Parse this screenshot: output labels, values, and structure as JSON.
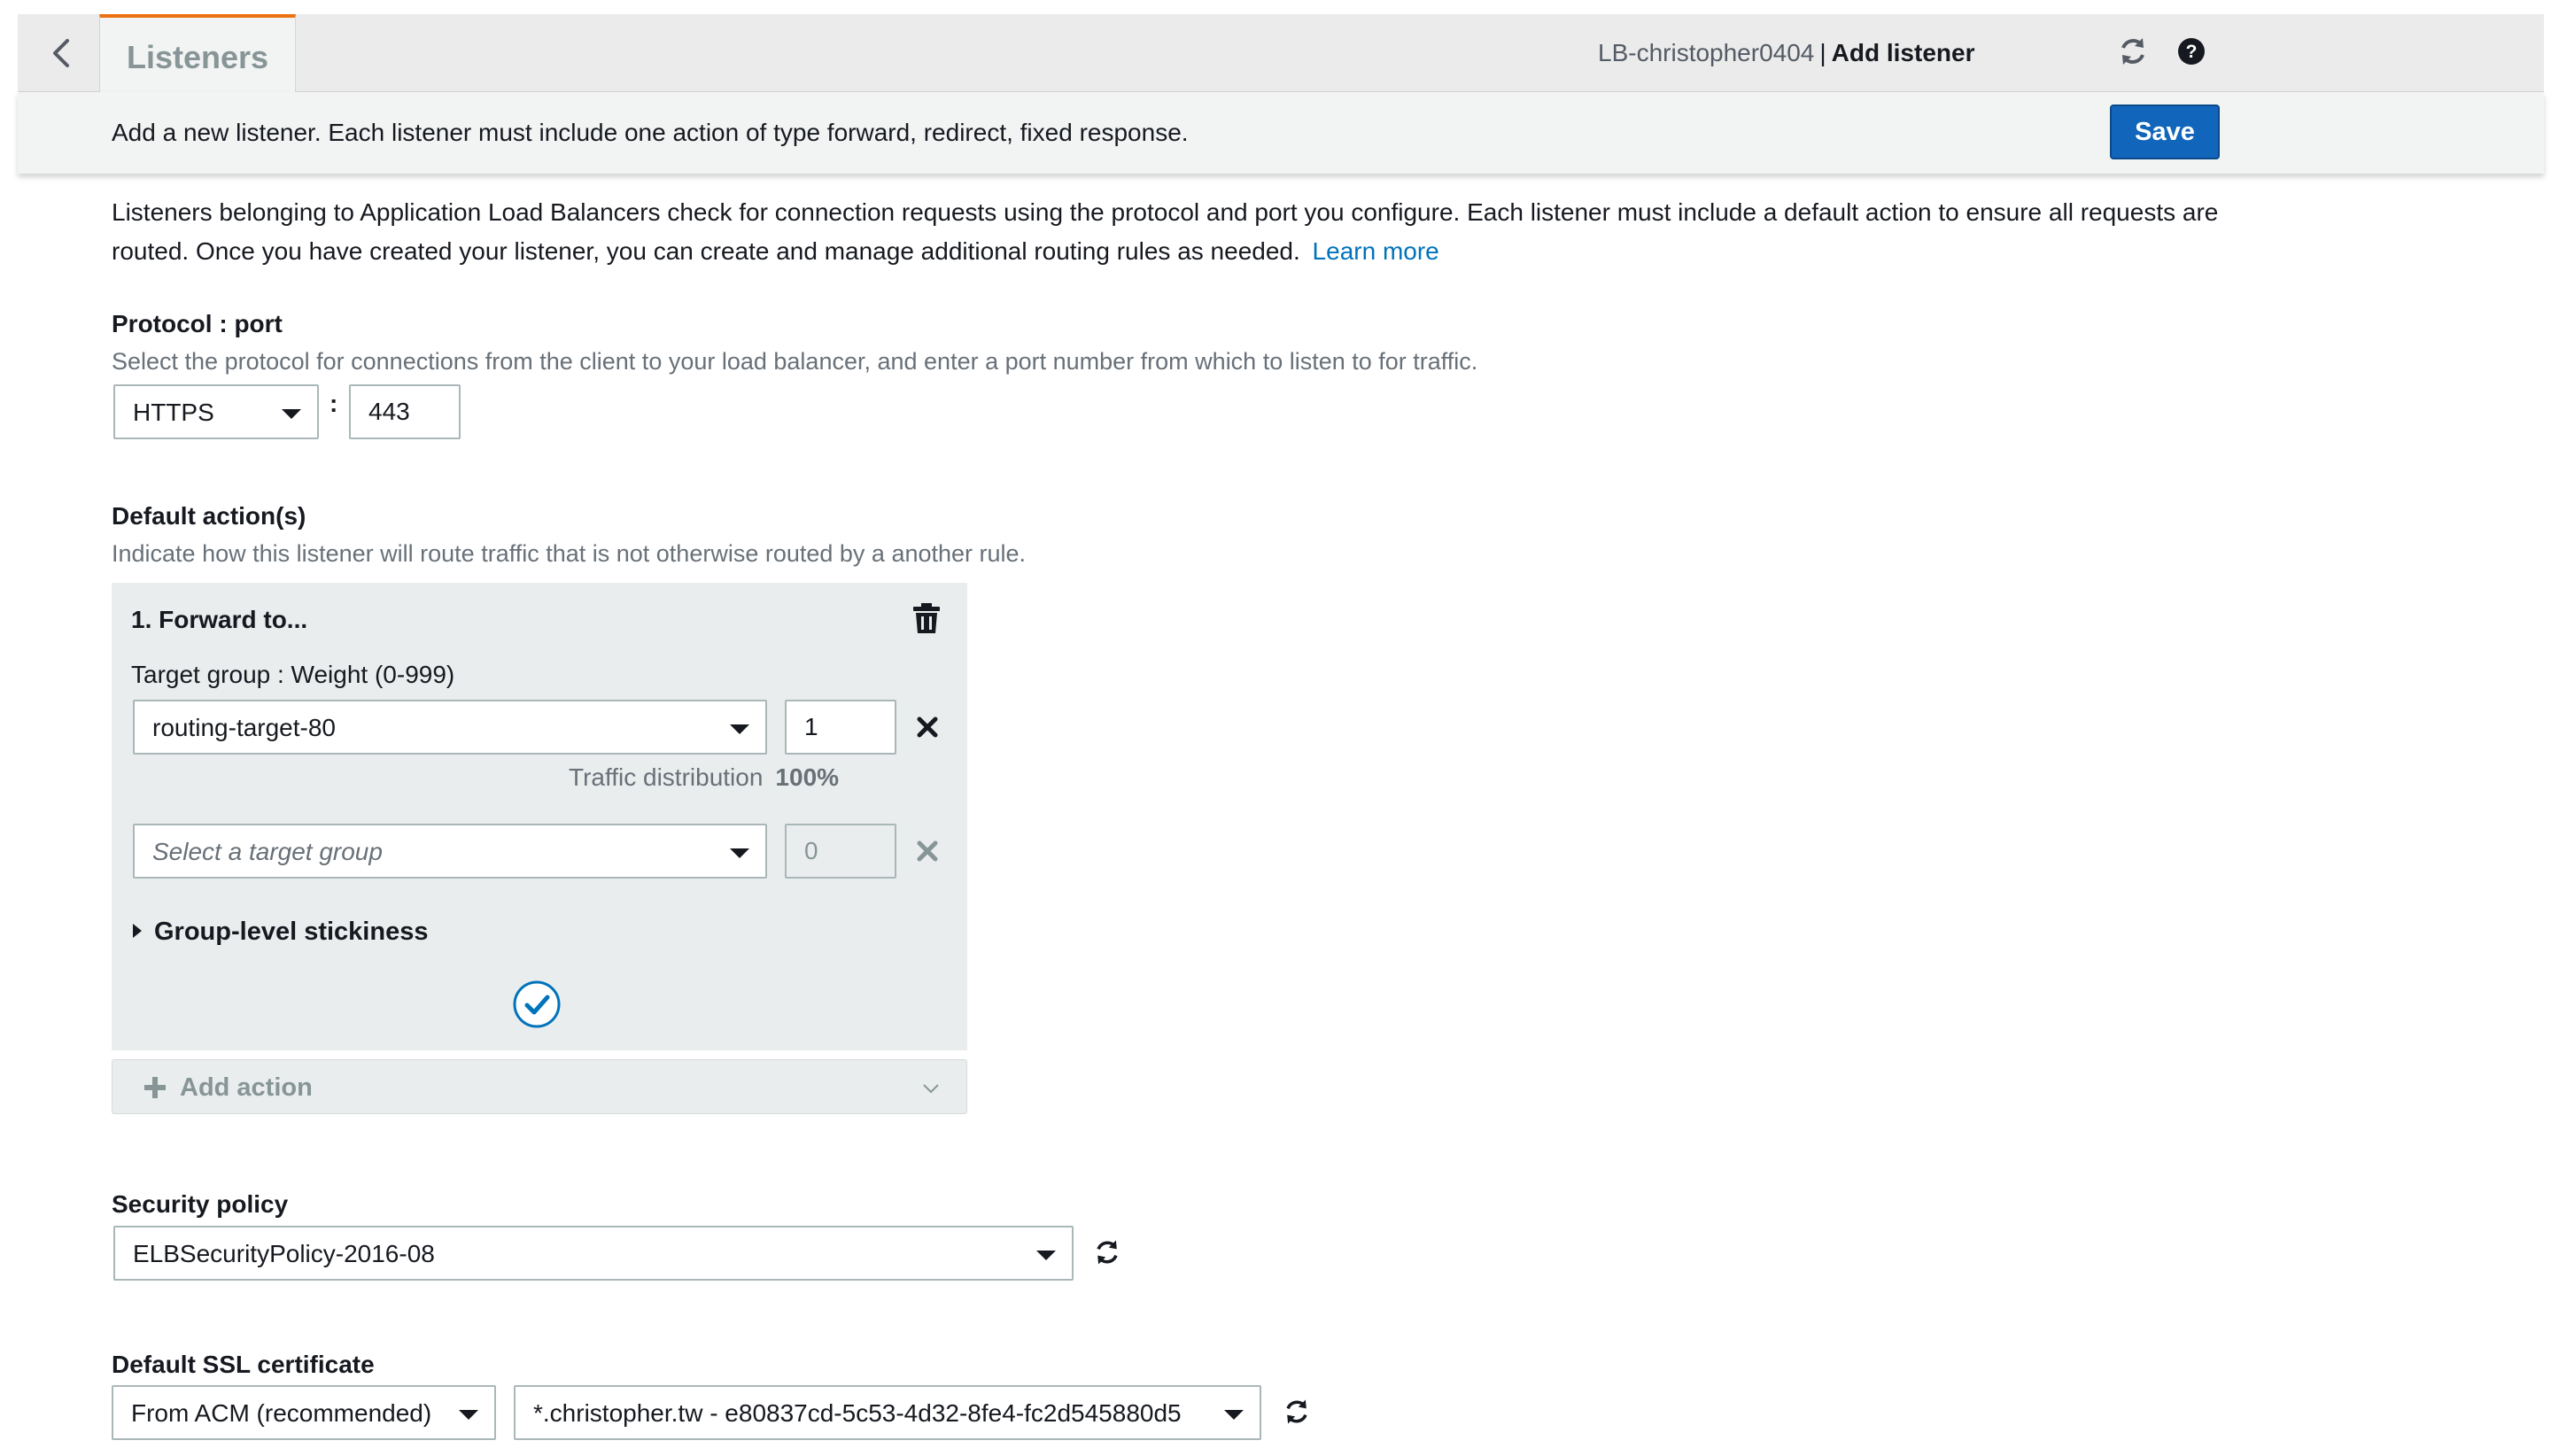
{
  "header": {
    "tab_label": "Listeners",
    "breadcrumb_lb": "LB-christopher0404",
    "breadcrumb_sep": "|",
    "breadcrumb_page": "Add listener"
  },
  "subheader": {
    "message": "Add a new listener. Each listener must include one action of type forward, redirect, fixed response.",
    "save_label": "Save"
  },
  "intro": {
    "text": "Listeners belonging to Application Load Balancers check for connection requests using the protocol and port you configure. Each listener must include a default action to ensure all requests are routed. Once you have created your listener, you can create and manage additional routing rules as needed.",
    "link": "Learn more"
  },
  "protocol": {
    "title": "Protocol : port",
    "description": "Select the protocol for connections from the client to your load balancer, and enter a port number from which to listen to for traffic.",
    "protocol_value": "HTTPS",
    "separator": ":",
    "port_value": "443"
  },
  "default_actions": {
    "title": "Default action(s)",
    "description": "Indicate how this listener will route traffic that is not otherwise routed by a another rule.",
    "action_title": "1. Forward to...",
    "target_group_label": "Target group : Weight (0-999)",
    "target_groups": [
      {
        "value": "routing-target-80",
        "weight": "1"
      },
      {
        "placeholder": "Select a target group",
        "weight": "0"
      }
    ],
    "traffic_label": "Traffic distribution",
    "traffic_value": "100%",
    "stickiness_label": "Group-level stickiness",
    "add_action_label": "Add action"
  },
  "security_policy": {
    "title": "Security policy",
    "value": "ELBSecurityPolicy-2016-08"
  },
  "ssl": {
    "title": "Default SSL certificate",
    "source_value": "From ACM (recommended)",
    "certificate_value": "*.christopher.tw - e80837cd-5c53-4d32-8fe4-fc2d545880d5"
  },
  "colors": {
    "accent": "#ec7211",
    "primary_button": "#1166bb",
    "link": "#0073bb",
    "panel_bg": "#eaeded"
  },
  "icons": [
    "chevron-left-icon",
    "refresh-icon",
    "help-icon",
    "trash-icon",
    "close-icon",
    "check-circle-icon",
    "plus-icon",
    "chevron-down-icon",
    "caret-right-icon"
  ]
}
